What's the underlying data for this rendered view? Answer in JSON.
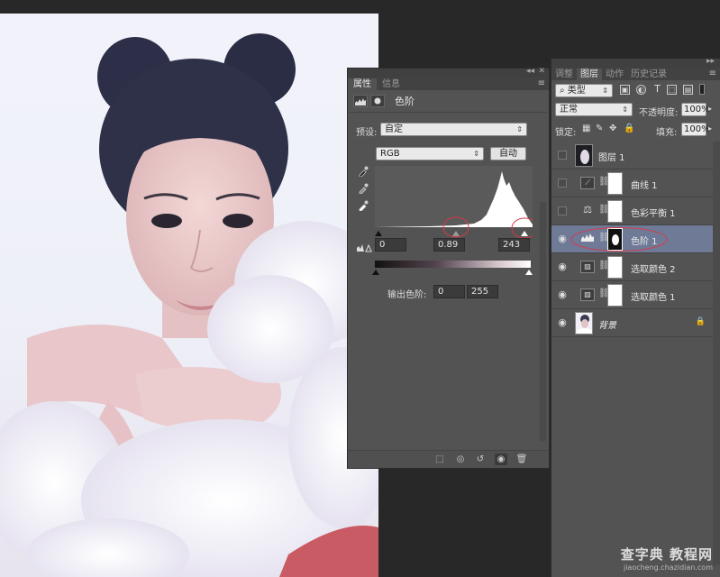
{
  "properties_panel": {
    "tabs": [
      "属性",
      "信息"
    ],
    "title": "色阶",
    "preset_label": "预设:",
    "preset_value": "自定",
    "channel_value": "RGB",
    "auto_button": "自动",
    "input_black": "0",
    "input_mid": "0.89",
    "input_white": "243",
    "output_label": "输出色阶:",
    "output_black": "0",
    "output_white": "255"
  },
  "layers_panel": {
    "tabs": [
      "调整",
      "图层",
      "动作",
      "历史记录"
    ],
    "filter_value": "类型",
    "blend_value": "正常",
    "opacity_label": "不透明度:",
    "opacity_value": "100%",
    "lock_label": "锁定:",
    "fill_label": "填充:",
    "fill_value": "100%",
    "layers": [
      {
        "name": "图层 1",
        "visible": false,
        "kind": "pixel"
      },
      {
        "name": "曲线 1",
        "visible": false,
        "kind": "curves"
      },
      {
        "name": "色彩平衡 1",
        "visible": false,
        "kind": "balance"
      },
      {
        "name": "色阶 1",
        "visible": true,
        "kind": "levels",
        "selected": true
      },
      {
        "name": "选取颜色 2",
        "visible": true,
        "kind": "selective"
      },
      {
        "name": "选取颜色 1",
        "visible": true,
        "kind": "selective"
      },
      {
        "name": "背景",
        "visible": true,
        "kind": "background",
        "locked": true
      }
    ]
  },
  "watermark": {
    "line1": "查字典 教程网",
    "line2": "jiaocheng.chazidian.com"
  },
  "colors": {
    "panel_bg": "#535353",
    "selected_layer": "#6e7a96",
    "highlight_circle": "#d63a4a"
  }
}
